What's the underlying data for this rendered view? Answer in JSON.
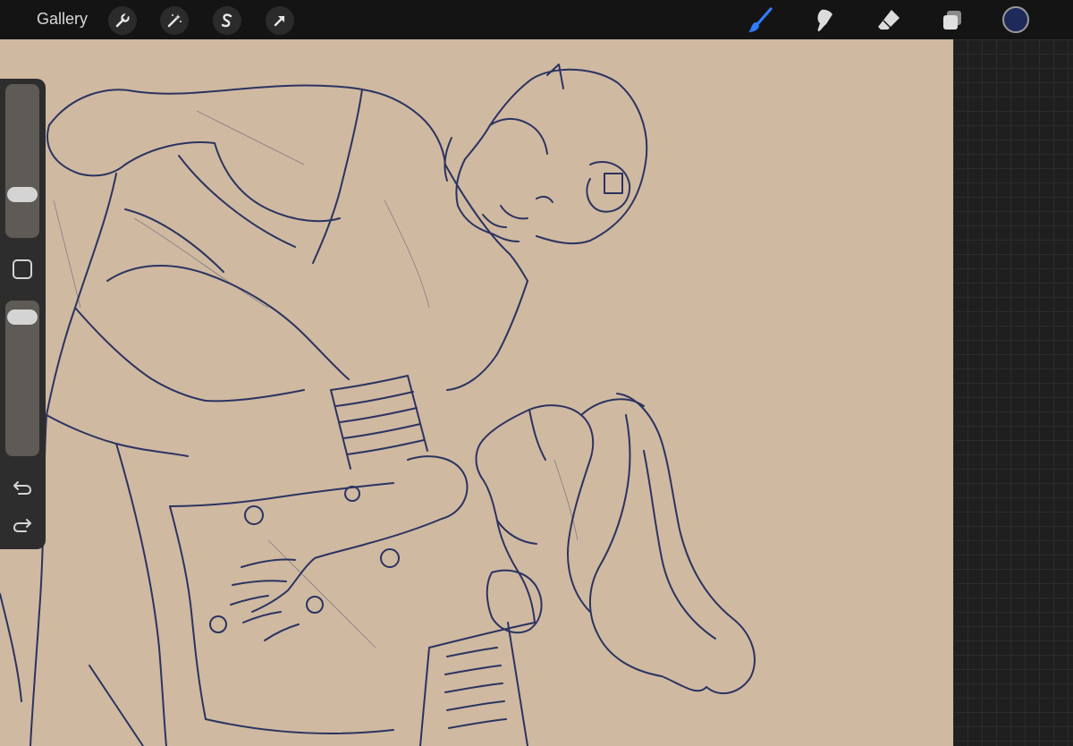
{
  "topbar": {
    "gallery_label": "Gallery",
    "left_tools": [
      "wrench-icon",
      "magic-wand-icon",
      "selection-icon",
      "transform-arrow-icon"
    ],
    "right_tools": [
      "brush-icon",
      "smudge-icon",
      "eraser-icon",
      "layers-icon"
    ],
    "active_tool": "brush-icon",
    "active_color": "#1d2a5a"
  },
  "sidebar": {
    "brush_size_level": 0.25,
    "opacity_level": 0.95,
    "undo_icon": "undo-icon",
    "redo_icon": "redo-icon"
  },
  "canvas": {
    "background": "#cfb9a1",
    "line_color": "#2b3360"
  }
}
